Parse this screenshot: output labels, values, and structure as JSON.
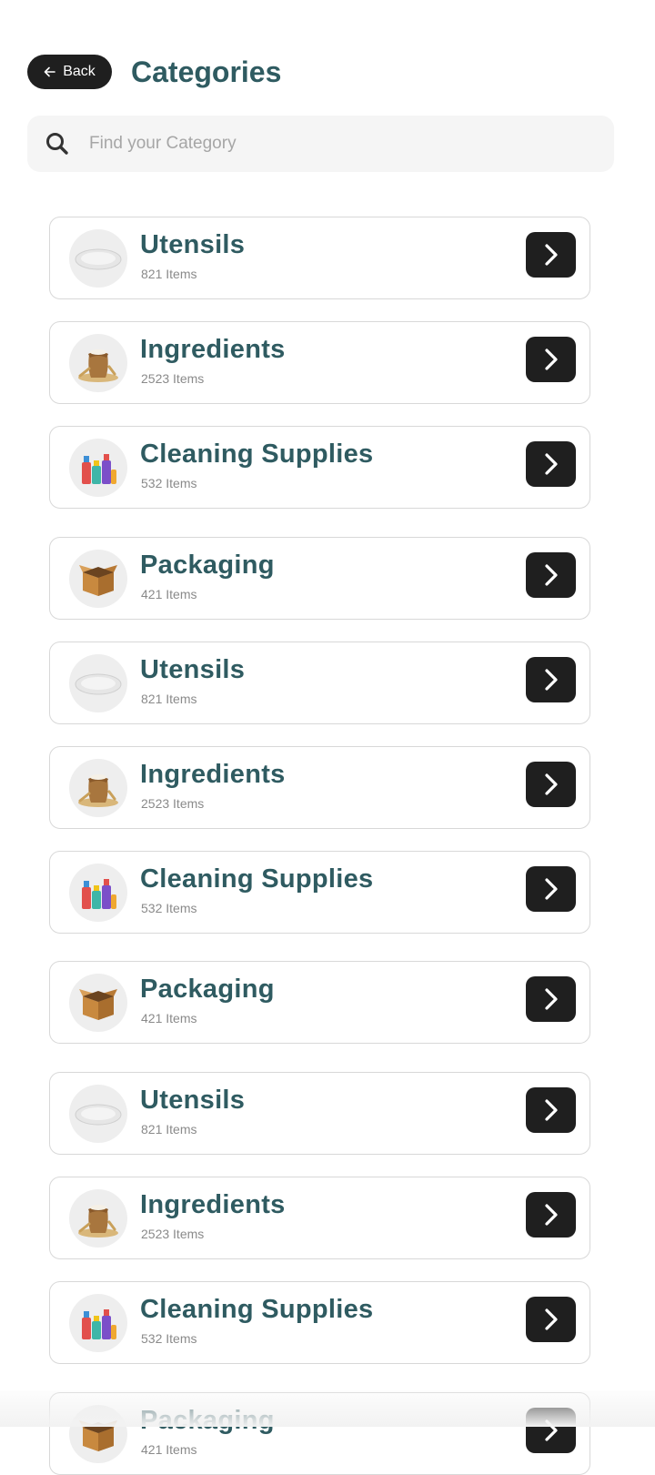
{
  "header": {
    "back_label": "Back",
    "title": "Categories"
  },
  "search": {
    "placeholder": "Find your Category",
    "value": ""
  },
  "categories": [
    {
      "name": "Utensils",
      "count": "821 Items",
      "icon": "plate-icon"
    },
    {
      "name": "Ingredients",
      "count": "2523 Items",
      "icon": "grain-sack-icon"
    },
    {
      "name": "Cleaning Supplies",
      "count": "532 Items",
      "icon": "cleaning-bottles-icon"
    },
    {
      "name": "Packaging",
      "count": "421 Items",
      "icon": "cardboard-box-icon"
    },
    {
      "name": "Utensils",
      "count": "821 Items",
      "icon": "plate-icon"
    },
    {
      "name": "Ingredients",
      "count": "2523 Items",
      "icon": "grain-sack-icon"
    },
    {
      "name": "Cleaning Supplies",
      "count": "532 Items",
      "icon": "cleaning-bottles-icon"
    },
    {
      "name": "Packaging",
      "count": "421 Items",
      "icon": "cardboard-box-icon"
    },
    {
      "name": "Utensils",
      "count": "821 Items",
      "icon": "plate-icon"
    },
    {
      "name": "Ingredients",
      "count": "2523 Items",
      "icon": "grain-sack-icon"
    },
    {
      "name": "Cleaning Supplies",
      "count": "532 Items",
      "icon": "cleaning-bottles-icon"
    },
    {
      "name": "Packaging",
      "count": "421 Items",
      "icon": "cardboard-box-icon"
    }
  ],
  "colors": {
    "title": "#2f5b61",
    "button": "#1f1f1f",
    "card_border": "#d8d8d8"
  }
}
